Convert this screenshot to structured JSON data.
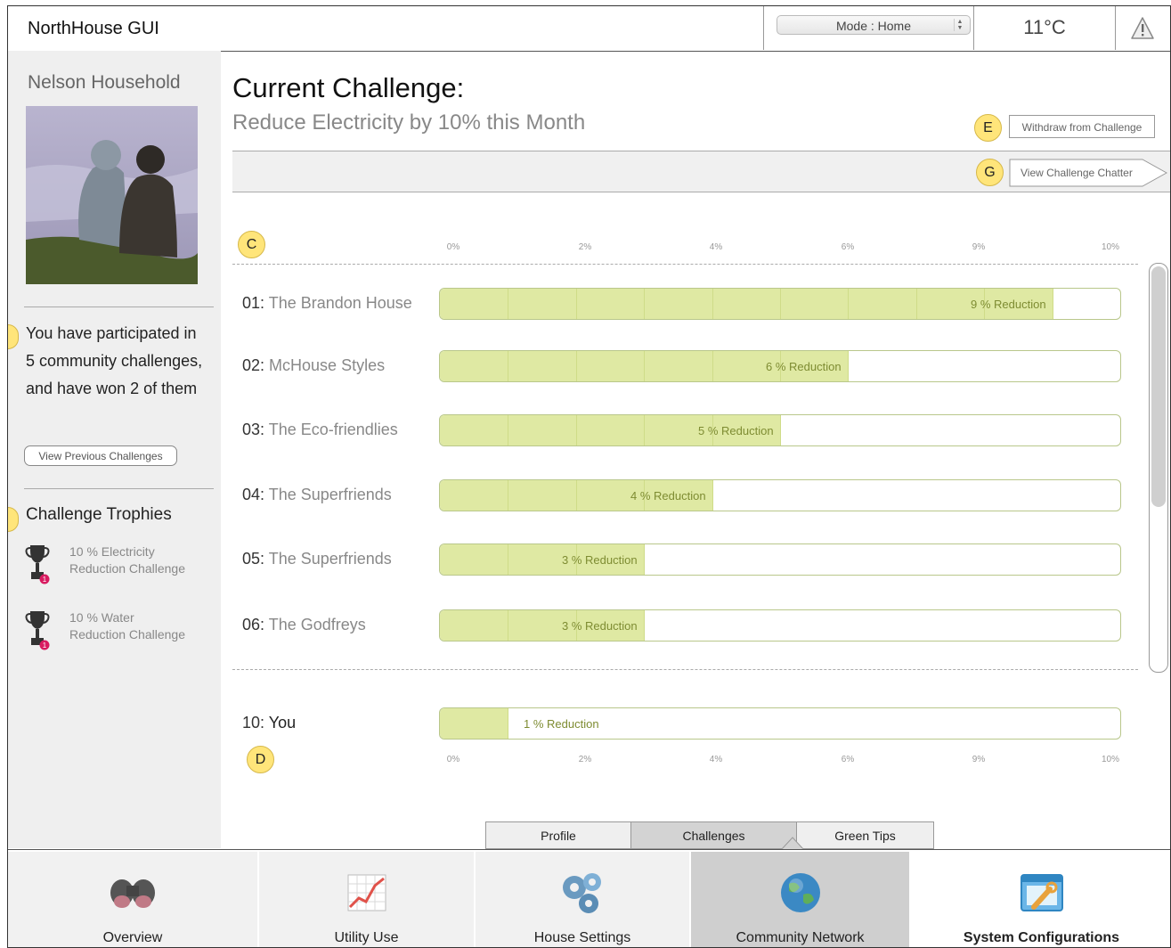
{
  "app": {
    "title": "NorthHouse GUI"
  },
  "topbar": {
    "mode": "Mode : Home",
    "temperature": "11°C"
  },
  "sidebar": {
    "household": "Nelson Household",
    "participation_text": "You have participated in 5 community challenges, and have won 2 of them",
    "view_previous_label": "View Previous Challenges",
    "trophies_title": "Challenge Trophies",
    "trophies": [
      {
        "line1": "10 %  Electricity",
        "line2": "Reduction Challenge",
        "count": "1"
      },
      {
        "line1": "10 %  Water",
        "line2": "Reduction Challenge",
        "count": "1"
      }
    ]
  },
  "challenge": {
    "title": "Current Challenge:",
    "subtitle": "Reduce Electricity by 10% this Month",
    "withdraw_label": "Withdraw from Challenge",
    "chatter_label": "View Challenge Chatter",
    "markers": {
      "e": "E",
      "g": "G",
      "c": "C",
      "d": "D"
    },
    "axis_ticks": [
      "0%",
      "2%",
      "4%",
      "6%",
      "9%",
      "10%"
    ],
    "leaderboard": [
      {
        "rank": "01:",
        "name": "The Brandon House",
        "reduction": 9,
        "label": "9 % Reduction"
      },
      {
        "rank": "02:",
        "name": "McHouse Styles",
        "reduction": 6,
        "label": "6 % Reduction"
      },
      {
        "rank": "03:",
        "name": "The Eco-friendlies",
        "reduction": 5,
        "label": "5 % Reduction"
      },
      {
        "rank": "04:",
        "name": "The Superfriends",
        "reduction": 4,
        "label": "4 % Reduction"
      },
      {
        "rank": "05:",
        "name": "The Superfriends",
        "reduction": 3,
        "label": "3 % Reduction"
      },
      {
        "rank": "06:",
        "name": "The Godfreys",
        "reduction": 3,
        "label": "3 % Reduction"
      }
    ],
    "you": {
      "rank": "10:",
      "name": "You",
      "reduction": 1,
      "label": "1 % Reduction"
    }
  },
  "subtabs": [
    {
      "label": "Profile"
    },
    {
      "label": "Challenges"
    },
    {
      "label": "Green Tips"
    }
  ],
  "nav": [
    {
      "label": "Overview",
      "icon": "binoculars-icon"
    },
    {
      "label": "Utility Use",
      "icon": "line-chart-icon"
    },
    {
      "label": "House Settings",
      "icon": "gears-icon"
    },
    {
      "label": "Community Network",
      "icon": "globe-icon"
    },
    {
      "label": "System Configurations",
      "icon": "wrench-window-icon"
    }
  ]
}
